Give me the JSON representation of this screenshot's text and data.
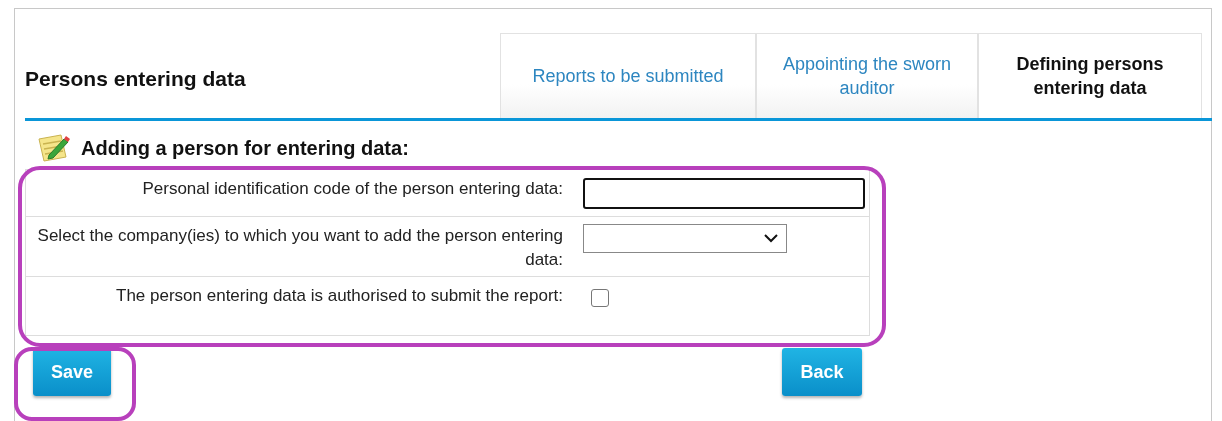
{
  "title": "Persons entering data",
  "tabs": [
    {
      "label": "Reports to be submitted",
      "selected": false
    },
    {
      "label": "Appointing the sworn auditor",
      "selected": false
    },
    {
      "label": "Defining persons entering data",
      "selected": true
    }
  ],
  "section": {
    "heading": "Adding a person for entering data:"
  },
  "form": {
    "highlighted": true,
    "fields": [
      {
        "kind": "text",
        "label": "Personal identification code of the person entering data:",
        "focused": true
      },
      {
        "kind": "select",
        "label": "Select the company(ies) to which you want to add the person entering data:"
      },
      {
        "kind": "checkbox",
        "label": "The person entering data is authorised to submit the report:",
        "checked": false
      }
    ]
  },
  "buttons": [
    {
      "label": "Save",
      "highlighted": true
    },
    {
      "label": "Back",
      "highlighted": false
    }
  ]
}
